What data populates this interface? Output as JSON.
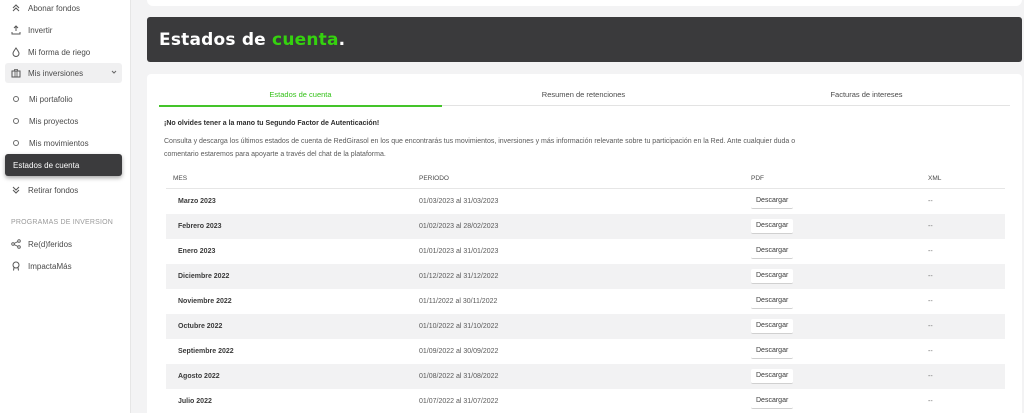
{
  "sidebar": {
    "items": [
      {
        "label": "Abonar fondos",
        "icon": "double-chevron-up-icon"
      },
      {
        "label": "Invertir",
        "icon": "invest-icon"
      },
      {
        "label": "Mi forma de riego",
        "icon": "drop-icon"
      },
      {
        "label": "Mis inversiones",
        "icon": "briefcase-icon"
      }
    ],
    "sub_items": [
      {
        "label": "Mi portafolio"
      },
      {
        "label": "Mis proyectos"
      },
      {
        "label": "Mis movimientos"
      },
      {
        "label": "Estados de cuenta",
        "active": true
      }
    ],
    "withdraw_label": "Retirar fondos",
    "section_label": "PROGRAMAS DE INVERSION",
    "programs": [
      {
        "label": "Re(d)feridos",
        "icon": "share-icon"
      },
      {
        "label": "ImpactaMás",
        "icon": "badge-icon"
      }
    ]
  },
  "banner": {
    "title_main": "Estados de ",
    "title_accent": "cuenta",
    "title_end": "."
  },
  "tabs": [
    {
      "label": "Estados de cuenta",
      "active": true
    },
    {
      "label": "Resumen de retenciones",
      "active": false
    },
    {
      "label": "Facturas de intereses",
      "active": false
    }
  ],
  "notice": "¡No olvides tener a la mano tu Segundo Factor de Autenticación!",
  "description": "Consulta y descarga los últimos estados de cuenta de RedGirasol en los que encontrarás tus movimientos, inversiones y más información relevante sobre tu participación en la Red. Ante cualquier duda o comentario estaremos para apoyarte a través del chat de la plataforma.",
  "table": {
    "headers": {
      "mes": "MES",
      "periodo": "PERIODO",
      "pdf": "PDF",
      "xml": "XML"
    },
    "download_label": "Descargar",
    "rows": [
      {
        "mes": "Marzo 2023",
        "periodo": "01/03/2023 al 31/03/2023",
        "xml": "--"
      },
      {
        "mes": "Febrero 2023",
        "periodo": "01/02/2023 al 28/02/2023",
        "xml": "--"
      },
      {
        "mes": "Enero 2023",
        "periodo": "01/01/2023 al 31/01/2023",
        "xml": "--"
      },
      {
        "mes": "Diciembre 2022",
        "periodo": "01/12/2022 al 31/12/2022",
        "xml": "--"
      },
      {
        "mes": "Noviembre 2022",
        "periodo": "01/11/2022 al 30/11/2022",
        "xml": "--"
      },
      {
        "mes": "Octubre 2022",
        "periodo": "01/10/2022 al 31/10/2022",
        "xml": "--"
      },
      {
        "mes": "Septiembre 2022",
        "periodo": "01/09/2022 al 30/09/2022",
        "xml": "--"
      },
      {
        "mes": "Agosto 2022",
        "periodo": "01/08/2022 al 31/08/2022",
        "xml": "--"
      },
      {
        "mes": "Julio 2022",
        "periodo": "01/07/2022 al 31/07/2022",
        "xml": "--"
      }
    ]
  },
  "colors": {
    "accent": "#35d20f",
    "banner_bg": "#3a3a3c",
    "active_item_bg": "#3b3b3d"
  }
}
